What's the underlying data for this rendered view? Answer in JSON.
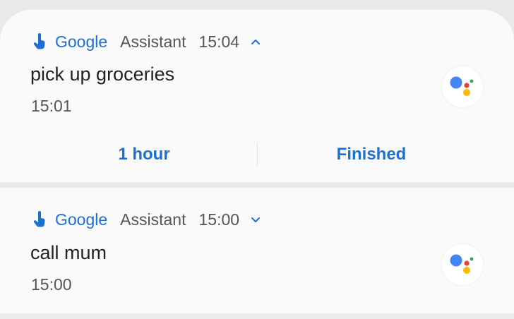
{
  "notifications": [
    {
      "app_name": "Google",
      "subtext": "Assistant",
      "time": "15:04",
      "expanded": true,
      "title": "pick up groceries",
      "subtime": "15:01",
      "actions": [
        {
          "label": "1 hour"
        },
        {
          "label": "Finished"
        }
      ]
    },
    {
      "app_name": "Google",
      "subtext": "Assistant",
      "time": "15:00",
      "expanded": false,
      "title": "call mum",
      "subtime": "15:00"
    }
  ],
  "colors": {
    "accent": "#1f6fd0",
    "assistant_blue": "#4285F4",
    "assistant_red": "#EA4335",
    "assistant_yellow": "#FBBC05",
    "assistant_green": "#34A853"
  },
  "icons": {
    "app_icon": "hand-pointer-icon",
    "expand_icon": "chevron-up-icon",
    "collapse_icon": "chevron-down-icon",
    "assistant_logo": "google-assistant-icon"
  }
}
